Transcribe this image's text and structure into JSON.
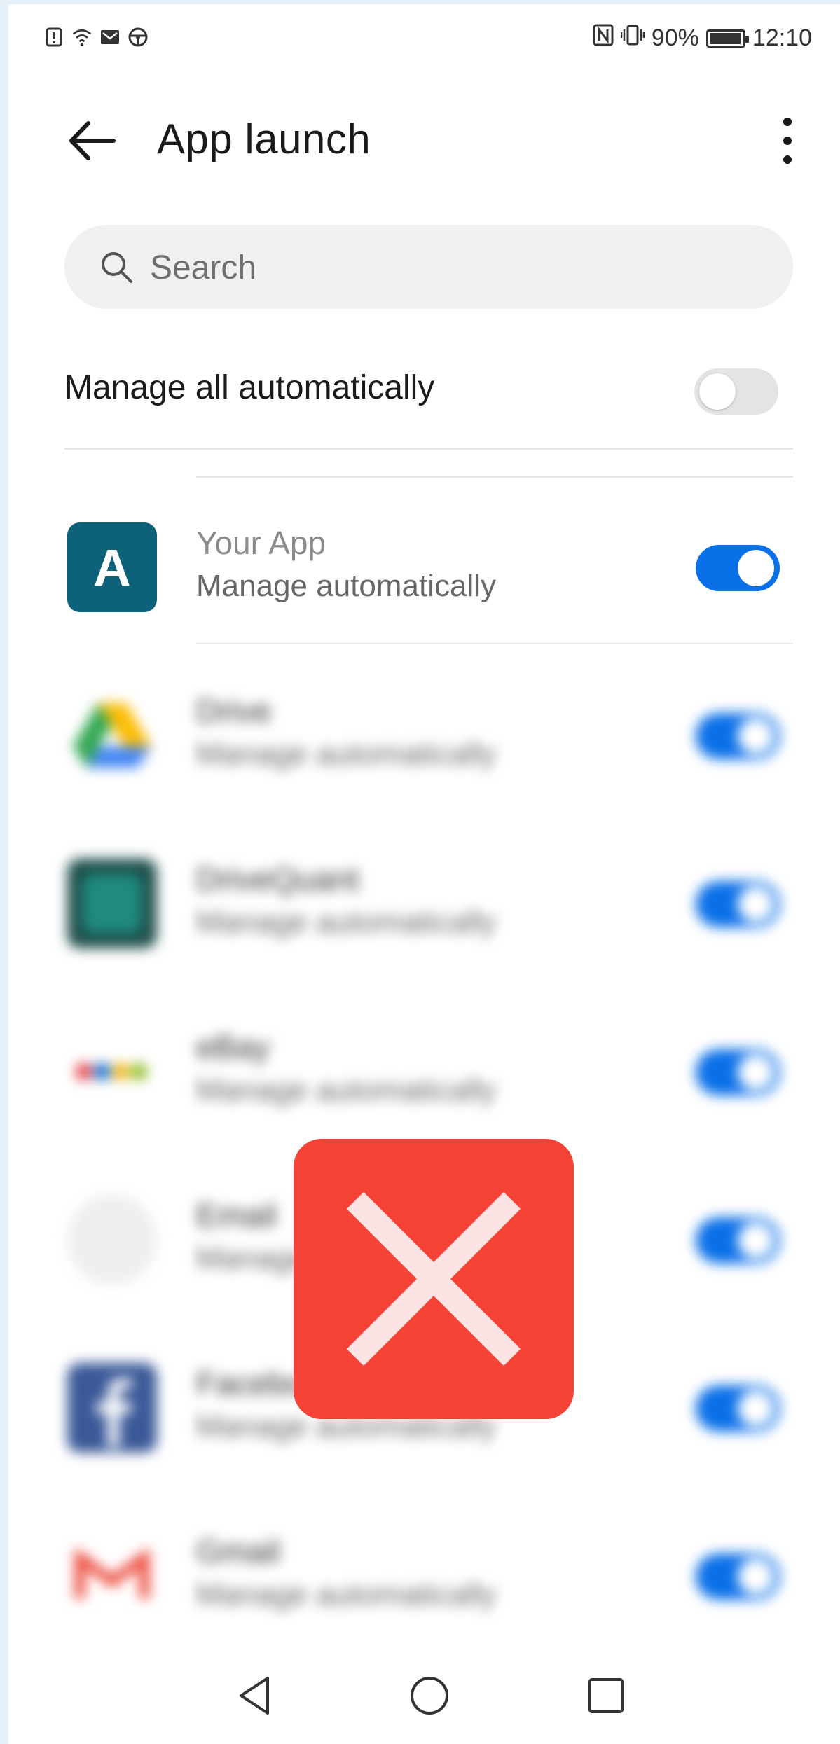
{
  "status_bar": {
    "battery": "90%",
    "time": "12:10"
  },
  "header": {
    "title": "App launch"
  },
  "search": {
    "placeholder": "Search"
  },
  "manage_all": {
    "label": "Manage all automatically",
    "enabled": false
  },
  "apps": [
    {
      "name": "Your App",
      "subtitle": "Manage automatically",
      "icon_letter": "A",
      "enabled": true,
      "blurred": false,
      "icon_color": "#0d6178"
    },
    {
      "name": "Drive",
      "subtitle": "Manage automatically",
      "enabled": true,
      "blurred": true,
      "icon": "drive-icon"
    },
    {
      "name": "DriveQuant",
      "subtitle": "Manage automatically",
      "enabled": true,
      "blurred": true,
      "icon": "drivequant-icon"
    },
    {
      "name": "eBay",
      "subtitle": "Manage automatically",
      "enabled": true,
      "blurred": true,
      "icon": "ebay-icon"
    },
    {
      "name": "Email",
      "subtitle": "Manage automatically",
      "enabled": true,
      "blurred": true,
      "icon": "email-icon"
    },
    {
      "name": "Facebook",
      "subtitle": "Manage automatically",
      "enabled": true,
      "blurred": true,
      "icon": "facebook-icon"
    },
    {
      "name": "Gmail",
      "subtitle": "Manage automatically",
      "enabled": true,
      "blurred": true,
      "icon": "gmail-icon"
    }
  ],
  "colors": {
    "accent": "#0a70e8",
    "error": "#f44336"
  }
}
